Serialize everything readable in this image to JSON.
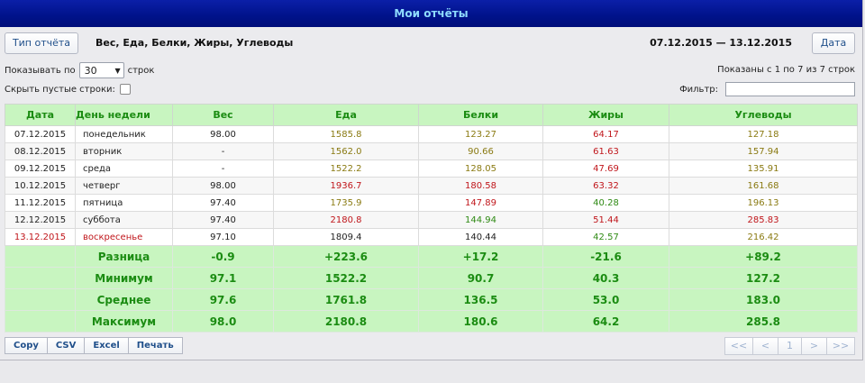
{
  "window": {
    "title": "Мои отчёты"
  },
  "toolbar": {
    "report_type_label": "Тип отчёта",
    "report_title": "Вес, Еда, Белки, Жиры, Углеводы",
    "date_range": "07.12.2015 — 13.12.2015",
    "date_label": "Дата"
  },
  "controls": {
    "show_prefix": "Показывать по",
    "rows_per_page": "30",
    "show_suffix": "строк",
    "hide_empty_label": "Скрыть пустые строки:",
    "hide_empty_checked": false,
    "summary": "Показаны с 1 по 7 из 7 строк",
    "filter_label": "Фильтр:",
    "filter_value": ""
  },
  "table": {
    "headers": [
      "Дата",
      "День недели",
      "Вес",
      "Еда",
      "Белки",
      "Жиры",
      "Углеводы"
    ],
    "rows": [
      {
        "date": "07.12.2015",
        "day": "понедельник",
        "weight": "98.00",
        "food": "1585.8",
        "protein": "123.27",
        "fat": "64.17",
        "carbs": "127.18"
      },
      {
        "date": "08.12.2015",
        "day": "вторник",
        "weight": "-",
        "food": "1562.0",
        "protein": "90.66",
        "fat": "61.63",
        "carbs": "157.94"
      },
      {
        "date": "09.12.2015",
        "day": "среда",
        "weight": "-",
        "food": "1522.2",
        "protein": "128.05",
        "fat": "47.69",
        "carbs": "135.91"
      },
      {
        "date": "10.12.2015",
        "day": "четверг",
        "weight": "98.00",
        "food": "1936.7",
        "protein": "180.58",
        "fat": "63.32",
        "carbs": "161.68"
      },
      {
        "date": "11.12.2015",
        "day": "пятница",
        "weight": "97.40",
        "food": "1735.9",
        "protein": "147.89",
        "fat": "40.28",
        "carbs": "196.13"
      },
      {
        "date": "12.12.2015",
        "day": "суббота",
        "weight": "97.40",
        "food": "2180.8",
        "protein": "144.94",
        "fat": "51.44",
        "carbs": "285.83"
      },
      {
        "date": "13.12.2015",
        "day": "воскресенье",
        "weight": "97.10",
        "food": "1809.4",
        "protein": "140.44",
        "fat": "42.57",
        "carbs": "216.42"
      }
    ],
    "summary_rows": [
      {
        "label": "Разница",
        "weight": "-0.9",
        "food": "+223.6",
        "protein": "+17.2",
        "fat": "-21.6",
        "carbs": "+89.2"
      },
      {
        "label": "Минимум",
        "weight": "97.1",
        "food": "1522.2",
        "protein": "90.7",
        "fat": "40.3",
        "carbs": "127.2"
      },
      {
        "label": "Среднее",
        "weight": "97.6",
        "food": "1761.8",
        "protein": "136.5",
        "fat": "53.0",
        "carbs": "183.0"
      },
      {
        "label": "Максимум",
        "weight": "98.0",
        "food": "2180.8",
        "protein": "180.6",
        "fat": "64.2",
        "carbs": "285.8"
      }
    ]
  },
  "export": {
    "copy": "Copy",
    "csv": "CSV",
    "excel": "Excel",
    "print": "Печать"
  },
  "pager": {
    "first": "<<",
    "prev": "<",
    "page": "1",
    "next": ">",
    "last": ">>"
  },
  "colors": {
    "title_bg": "#000e8a",
    "title_text": "#8fdcff",
    "header_bg": "#c8f5c0",
    "header_text": "#1b8c12",
    "red": "#c0161b",
    "olive": "#8a7a12",
    "green": "#2f8a14"
  }
}
